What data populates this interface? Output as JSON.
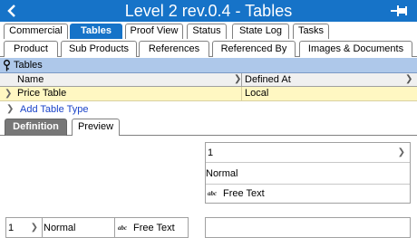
{
  "window": {
    "title": "Level 2 rev.0.4 - Tables"
  },
  "tabs_row1": [
    {
      "label": "Commercial",
      "active": false
    },
    {
      "label": "Tables",
      "active": true
    },
    {
      "label": "Proof View",
      "active": false
    },
    {
      "label": "Status",
      "active": false
    },
    {
      "label": "State Log",
      "active": false
    },
    {
      "label": "Tasks",
      "active": false
    }
  ],
  "tabs_row2": [
    {
      "label": "Product"
    },
    {
      "label": "Sub Products"
    },
    {
      "label": "References"
    },
    {
      "label": "Referenced By"
    },
    {
      "label": "Images & Documents"
    }
  ],
  "tables_section": {
    "header": "Tables",
    "columns": [
      "Name",
      "Defined At"
    ],
    "rows": [
      {
        "name": "Price Table",
        "defined_at": "Local"
      }
    ],
    "add_link": "Add Table Type"
  },
  "subtabs": [
    {
      "label": "Definition",
      "active": true
    },
    {
      "label": "Preview",
      "active": false
    }
  ],
  "definition": {
    "top_box": {
      "number": "1",
      "name": "Normal",
      "type_icon": "abc",
      "type": "Free Text"
    },
    "bottom_row": {
      "number": "1",
      "name": "Normal",
      "type_icon": "abc",
      "type": "Free Text"
    }
  },
  "colors": {
    "title_bar": "#1673c8",
    "section_header": "#aec8ea",
    "selected_row": "#fff7c2",
    "link": "#1a43c8"
  }
}
